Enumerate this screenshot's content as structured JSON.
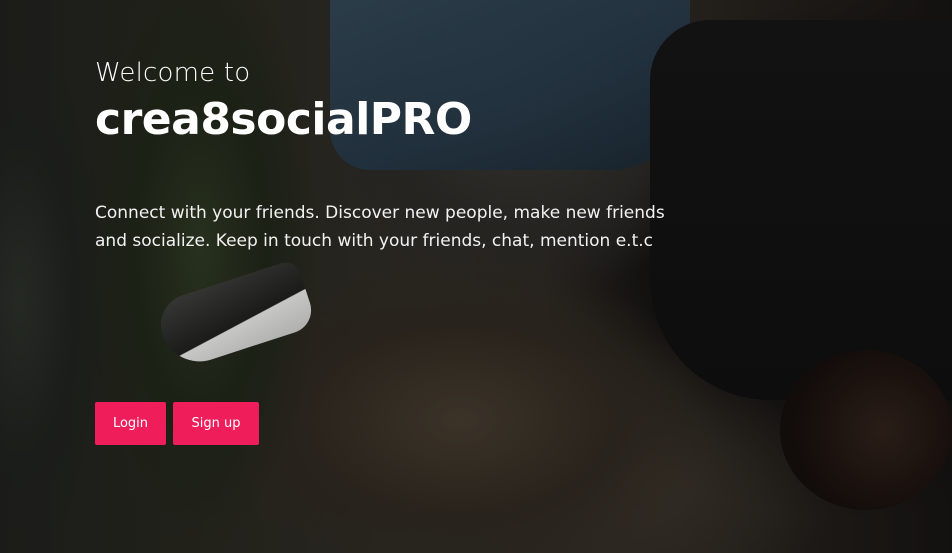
{
  "hero": {
    "welcome_text": "Welcome to",
    "brand_name": "crea8socialPRO",
    "tagline": "Connect with your friends. Discover new people, make new friends and socialize. Keep in touch with your friends, chat, mention e.t.c"
  },
  "actions": {
    "login_label": "Login",
    "signup_label": "Sign up"
  },
  "colors": {
    "accent": "#ef1e5b",
    "text": "#ffffff"
  }
}
